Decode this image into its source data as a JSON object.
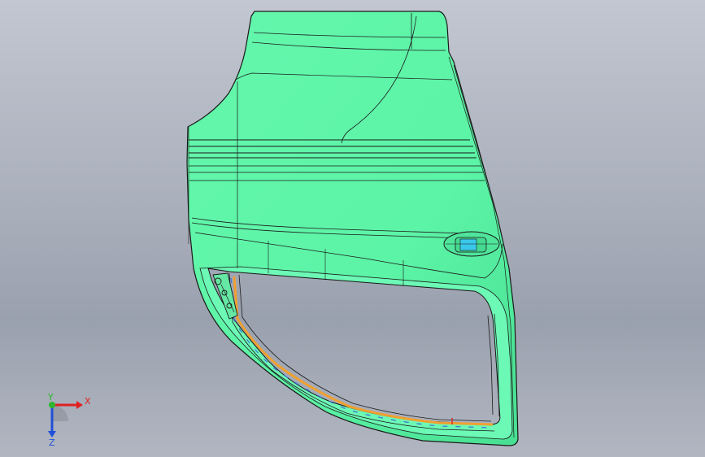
{
  "viewport": {
    "background_top": "#c2c7d1",
    "background_bottom": "#9aa1ae"
  },
  "model": {
    "part": "car-door-inner-panel",
    "surface_color": "#5cf4a6",
    "edge_color": "#1a1a1a",
    "seal_color_primary": "#f0a030",
    "seal_color_secondary": "#3f6fd8"
  },
  "triad": {
    "x_label": "X",
    "y_label": "Y",
    "z_label": "Z",
    "x_color": "#e02020",
    "y_color": "#2db52d",
    "z_color": "#2050d8"
  }
}
